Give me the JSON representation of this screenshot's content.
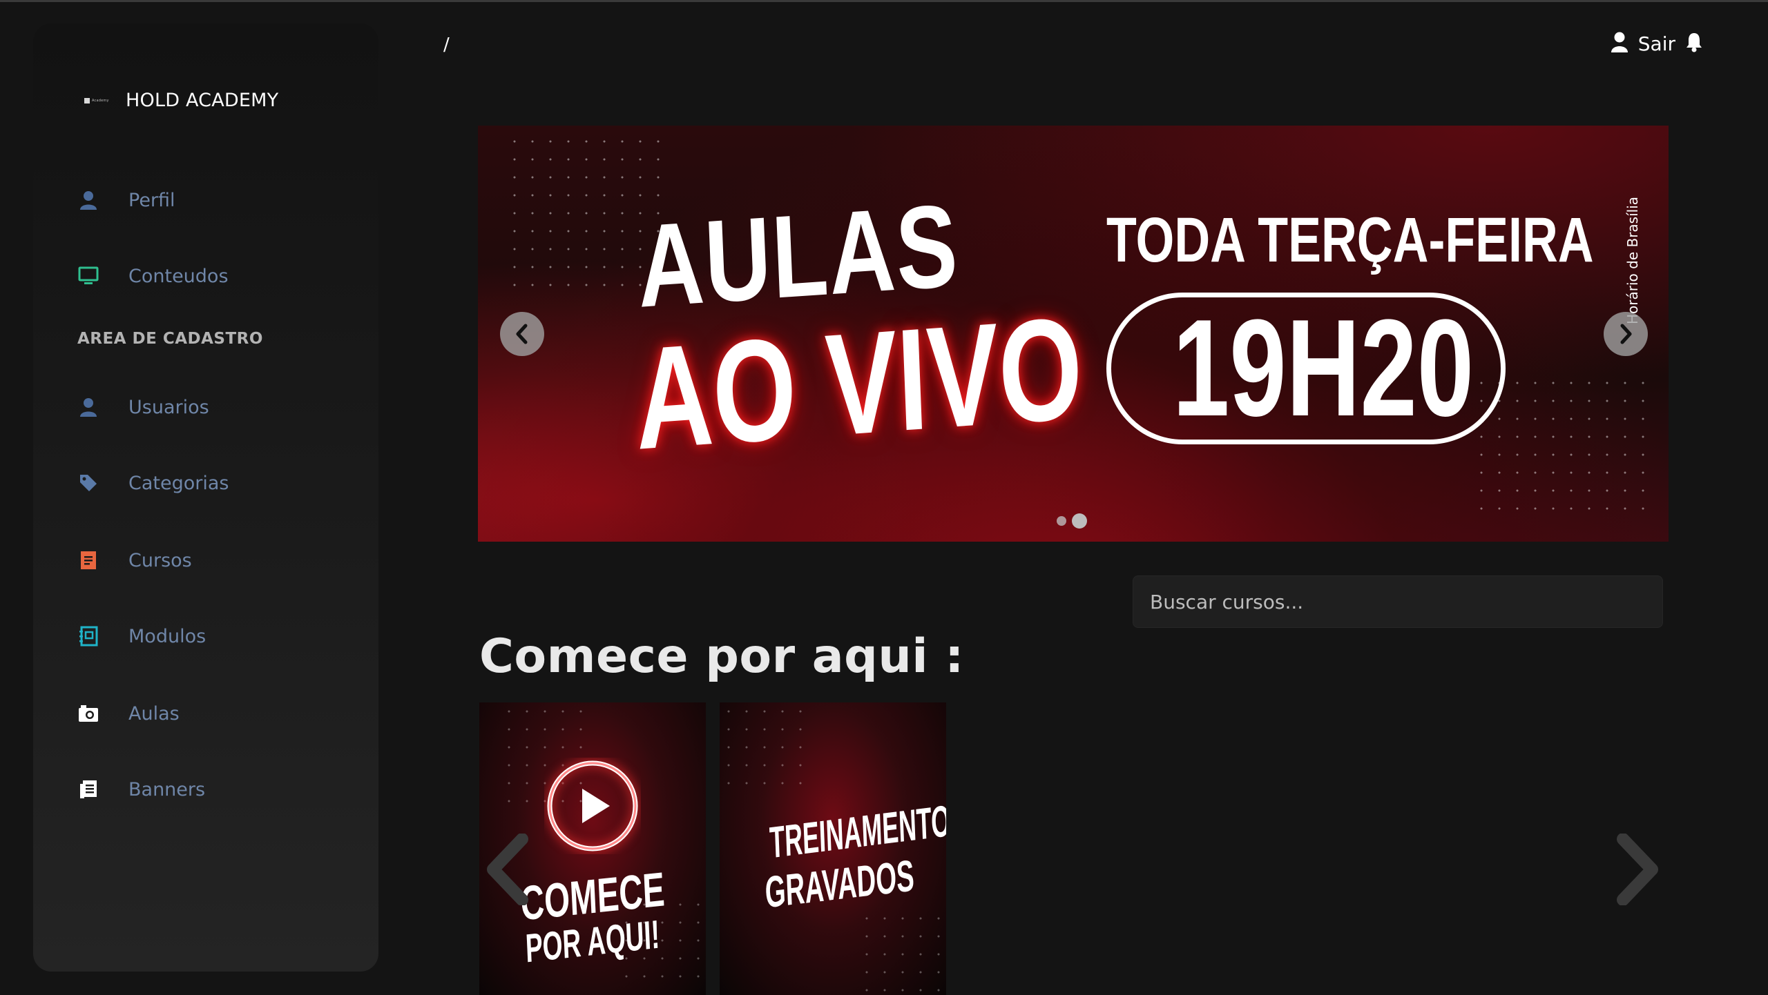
{
  "brand": {
    "logo_text": "Academy",
    "name": "HOLD ACADEMY"
  },
  "sidebar": {
    "items": [
      {
        "label": "Perfil",
        "icon": "user-icon",
        "color": "#4a6a9a"
      },
      {
        "label": "Conteudos",
        "icon": "monitor-icon",
        "color": "#2fbf8f"
      }
    ],
    "section_title": "AREA DE CADASTRO",
    "admin_items": [
      {
        "label": "Usuarios",
        "icon": "user-icon",
        "color": "#4a6a9a"
      },
      {
        "label": "Categorias",
        "icon": "tag-icon",
        "color": "#5a7aa8"
      },
      {
        "label": "Cursos",
        "icon": "document-icon",
        "color": "#e8663f"
      },
      {
        "label": "Modulos",
        "icon": "notebook-icon",
        "color": "#1fb3c8"
      },
      {
        "label": "Aulas",
        "icon": "camera-icon",
        "color": "#ffffff"
      },
      {
        "label": "Banners",
        "icon": "newspaper-icon",
        "color": "#ffffff"
      }
    ]
  },
  "header": {
    "breadcrumb": "/",
    "logout_label": "Sair",
    "user_icon": "user-icon",
    "bell_icon": "bell-icon"
  },
  "banner": {
    "line1": "AULAS",
    "line2": "AO VIVO",
    "day": "TODA TERÇA-FEIRA",
    "time": "19H20",
    "note": "Horário de Brasília",
    "slide_count": 2,
    "active_slide": 2,
    "prev_icon": "chevron-left-icon",
    "next_icon": "chevron-right-icon"
  },
  "search": {
    "placeholder": "Buscar cursos..."
  },
  "section": {
    "title": "Comece por aqui :",
    "cards": [
      {
        "line1": "COMECE",
        "line2": "POR AQUI!",
        "icon": "play-icon"
      },
      {
        "line1": "TREINAMENTOS",
        "line2": "GRAVADOS"
      }
    ]
  },
  "colors": {
    "background": "#141414",
    "sidebar": "#1b1b1b",
    "accent_red": "#c8101e",
    "nav_text": "#6f86a8"
  }
}
